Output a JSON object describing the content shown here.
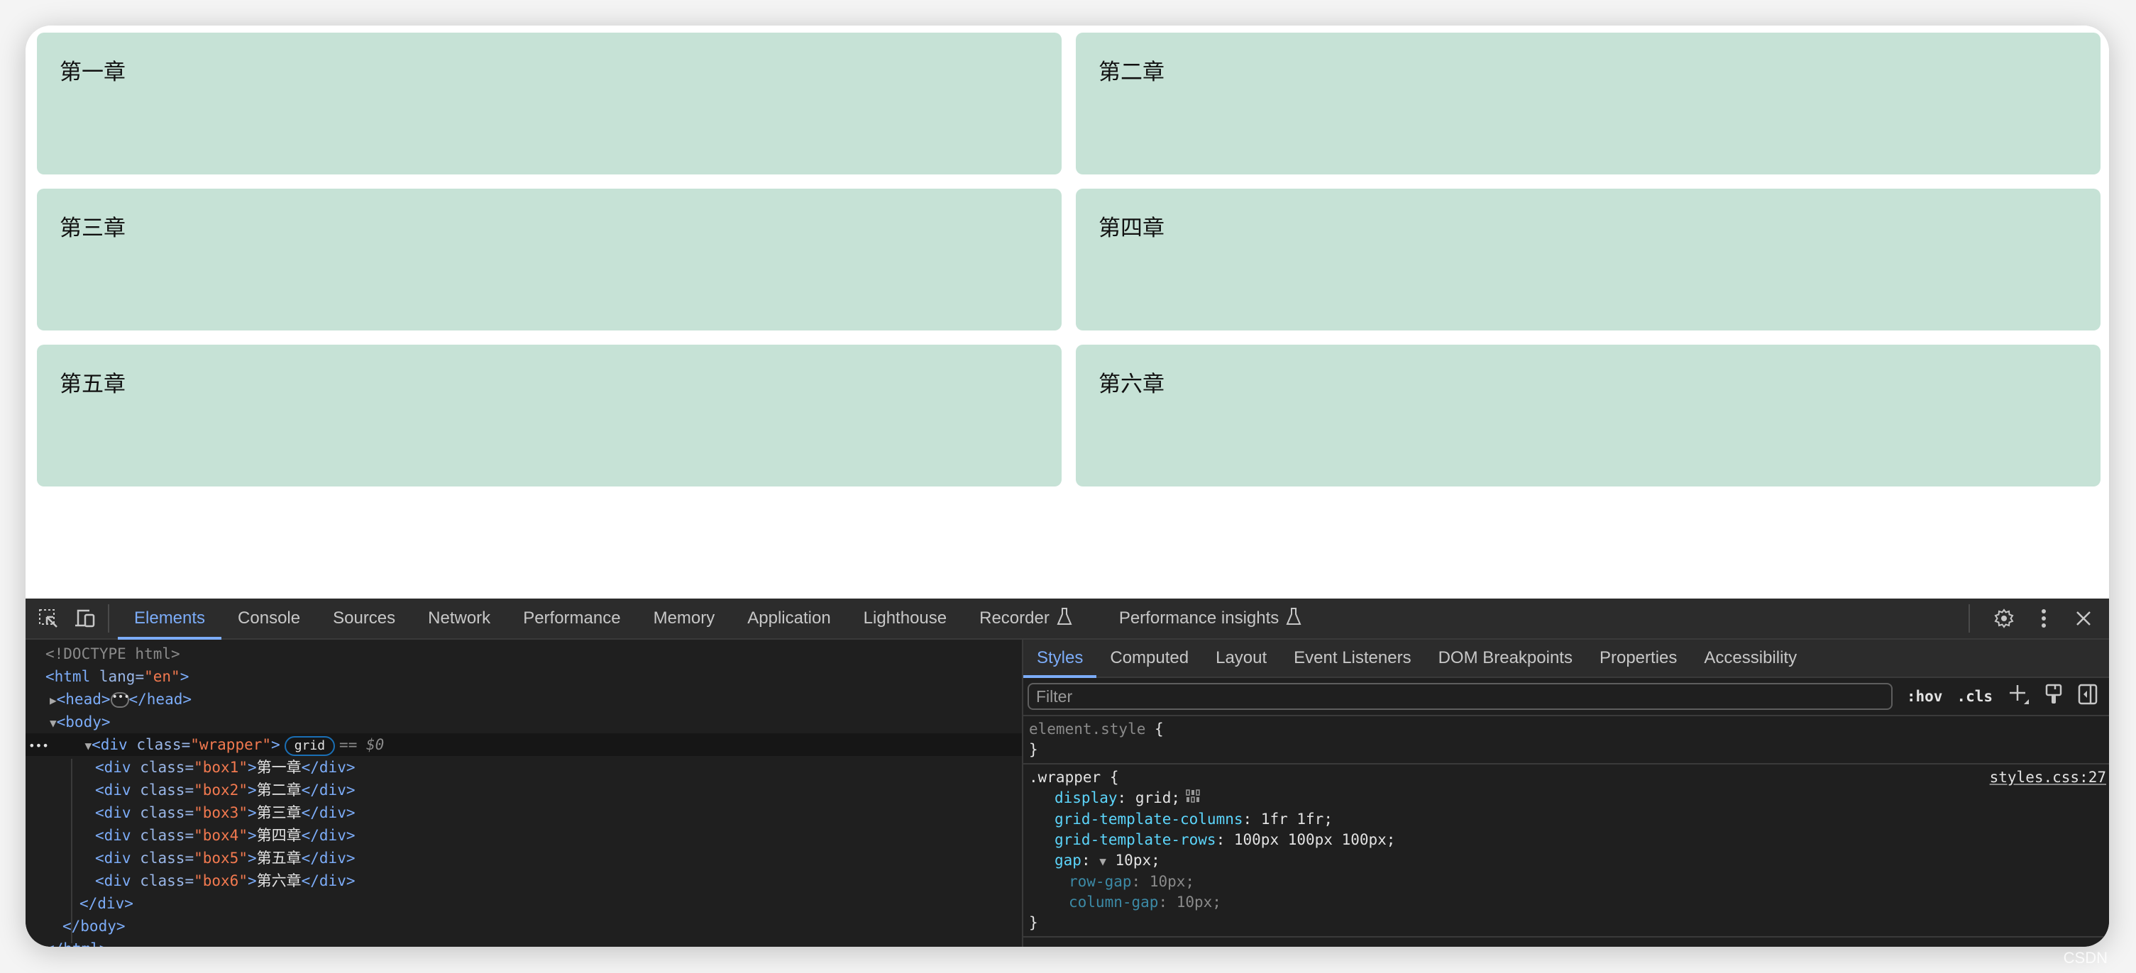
{
  "page": {
    "boxes": [
      {
        "label": "第一章"
      },
      {
        "label": "第二章"
      },
      {
        "label": "第三章"
      },
      {
        "label": "第四章"
      },
      {
        "label": "第五章"
      },
      {
        "label": "第六章"
      }
    ],
    "box_color": "#c6e2d6"
  },
  "devtools": {
    "tabs": [
      "Elements",
      "Console",
      "Sources",
      "Network",
      "Performance",
      "Memory",
      "Application",
      "Lighthouse",
      "Recorder",
      "Performance insights"
    ],
    "active_tab": "Elements",
    "experimental_tabs": [
      "Recorder",
      "Performance insights"
    ],
    "accent_color": "#7cacf8",
    "elements_tree": {
      "doctype": "<!DOCTYPE html>",
      "html_open": "<html",
      "html_attr": "lang",
      "html_attr_val": "\"en\"",
      "head_open": "<head>",
      "head_close": "</head>",
      "body_open": "<body>",
      "wrapper_open": "<div",
      "class_attr": "class",
      "wrapper_class": "\"wrapper\"",
      "grid_badge": "grid",
      "selected_marker": "== $0",
      "children": [
        {
          "class": "\"box1\"",
          "text": "第一章"
        },
        {
          "class": "\"box2\"",
          "text": "第二章"
        },
        {
          "class": "\"box3\"",
          "text": "第三章"
        },
        {
          "class": "\"box4\"",
          "text": "第四章"
        },
        {
          "class": "\"box5\"",
          "text": "第五章"
        },
        {
          "class": "\"box6\"",
          "text": "第六章"
        }
      ],
      "div_close": "</div>",
      "body_close": "</body>",
      "html_close": "</html>"
    },
    "styles_panel": {
      "tabs": [
        "Styles",
        "Computed",
        "Layout",
        "Event Listeners",
        "DOM Breakpoints",
        "Properties",
        "Accessibility"
      ],
      "active_tab": "Styles",
      "filter_placeholder": "Filter",
      "hov_label": ":hov",
      "cls_label": ".cls",
      "element_style_selector": "element.style",
      "rule": {
        "selector": ".wrapper",
        "source": "styles.css:27",
        "declarations": [
          {
            "prop": "display",
            "value": "grid;"
          },
          {
            "prop": "grid-template-columns",
            "value": "1fr 1fr;"
          },
          {
            "prop": "grid-template-rows",
            "value": "100px 100px 100px;"
          },
          {
            "prop": "gap",
            "value": "10px;"
          }
        ],
        "longhands": [
          {
            "prop": "row-gap",
            "value": "10px;"
          },
          {
            "prop": "column-gap",
            "value": "10px;"
          }
        ]
      }
    }
  },
  "watermark": "CSDN"
}
